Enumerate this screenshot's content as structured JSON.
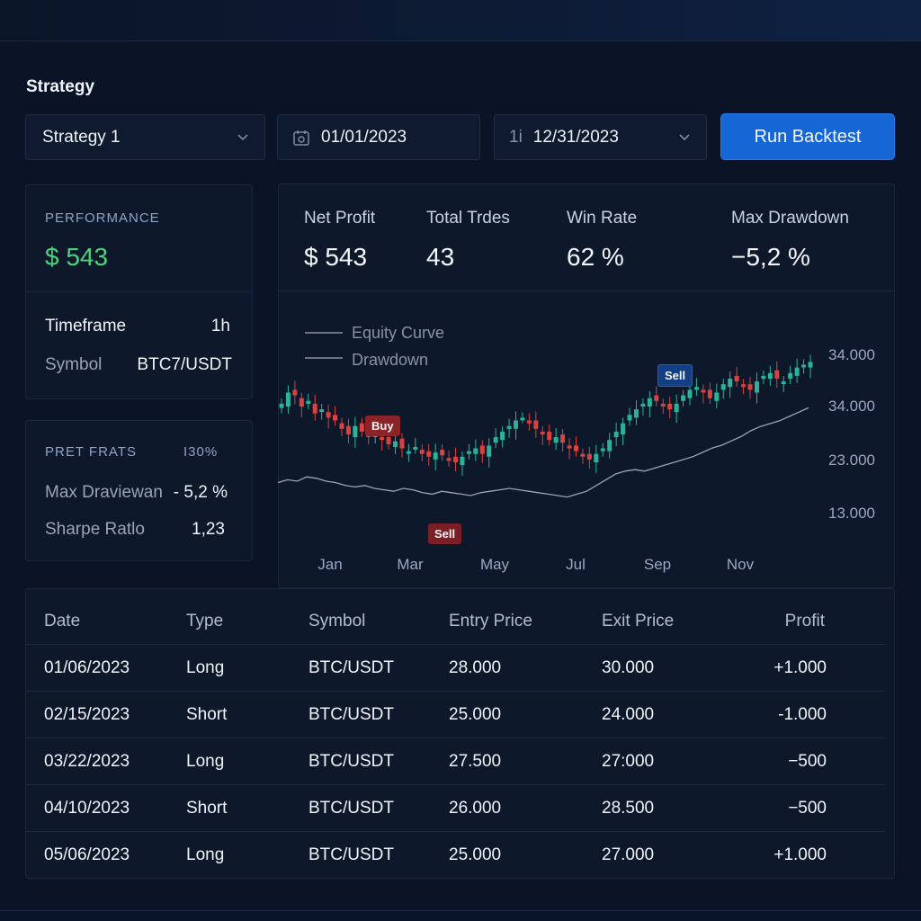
{
  "strategy": {
    "section_title": "Strategy",
    "selected": "Strategy 1",
    "start_date": "01/01/2023",
    "end_date": "12/31/2023",
    "end_date_icon_text": "1i",
    "run_label": "Run Backtest"
  },
  "performance": {
    "title": "PERFORMANCE",
    "value": "$ 543",
    "timeframe_label": "Timeframe",
    "timeframe_value": "1h",
    "symbol_label": "Symbol",
    "symbol_value": "BTC‌7/USDT"
  },
  "pret": {
    "title": "PRET FRATS",
    "badge": "I30%",
    "maxdd_label": "Max Draviewan",
    "maxdd_value": "- 5,2 %",
    "sharpe_label": "Sharpe Ratlo",
    "sharpe_value": "1,23"
  },
  "stats": [
    {
      "label": "Net Profit",
      "value": "$ 543"
    },
    {
      "label": "Total Trdes",
      "value": "43"
    },
    {
      "label": "Win Rate",
      "value": "62 %"
    },
    {
      "label": "Max Drawdown",
      "value": "−5,2 %"
    }
  ],
  "chart_data": {
    "type": "candlestick",
    "legend": [
      "Equity Curve",
      "Drawdown"
    ],
    "x_ticks": [
      "Jan",
      "Mar",
      "May",
      "Jul",
      "Sep",
      "Nov"
    ],
    "y_ticks": [
      "34.000",
      "34.000",
      "23.000",
      "13.000"
    ],
    "annotations": [
      {
        "label": "Buy",
        "month": "Feb"
      },
      {
        "label": "Sell",
        "month": "Apr"
      },
      {
        "label": "Sell",
        "month": "Sep"
      }
    ],
    "colors": {
      "up": "#2bb39a",
      "down": "#d9433f",
      "line": "#a9b3c4",
      "buy": "#8a2428",
      "sell_red": "#7a1f26",
      "sell_blue": "#123f86"
    },
    "candle_close_path": [
      62,
      70,
      68,
      60,
      64,
      55,
      58,
      52,
      50,
      44,
      40,
      46,
      42,
      38,
      40,
      36,
      33,
      35,
      30,
      28,
      31,
      26,
      24,
      27,
      25,
      22,
      20,
      24,
      28,
      30,
      26,
      32,
      38,
      42,
      46,
      50,
      52,
      48,
      44,
      40,
      36,
      38,
      34,
      30,
      28,
      24,
      22,
      26,
      30,
      36,
      42,
      48,
      54,
      58,
      62,
      66,
      64,
      60,
      58,
      62,
      68,
      72,
      74,
      70,
      66,
      70,
      76,
      80,
      78,
      74,
      72,
      78,
      82,
      84,
      80,
      78,
      84,
      88,
      90,
      92
    ],
    "line_path": [
      24,
      26,
      25,
      28,
      27,
      25,
      24,
      22,
      21,
      22,
      20,
      19,
      18,
      20,
      19,
      17,
      16,
      18,
      17,
      16,
      15,
      17,
      18,
      19,
      20,
      19,
      18,
      17,
      16,
      15,
      14,
      16,
      18,
      22,
      26,
      30,
      32,
      33,
      32,
      34,
      36,
      38,
      40,
      42,
      45,
      48,
      50,
      53,
      56,
      60,
      63,
      65,
      67,
      70,
      73,
      76
    ]
  },
  "table": {
    "headers": [
      "Date",
      "Type",
      "Symbol",
      "Entry Price",
      "Exit Price",
      "Profit"
    ],
    "rows": [
      {
        "date": "01/06/2023",
        "type": "Long",
        "symbol": "BTC/USDT",
        "entry": "28.000",
        "exit": "30.000",
        "profit": "+1.000",
        "pos": true
      },
      {
        "date": "02/15/2023",
        "type": "Short",
        "symbol": "BTC/USDT",
        "entry": "25.000",
        "exit": "24.000",
        "profit": "-1.000",
        "pos": false
      },
      {
        "date": "03/22/2023",
        "type": "Long",
        "symbol": "BTC/USDT",
        "entry": "27.500",
        "exit": "27:000",
        "profit": "−500",
        "pos": false
      },
      {
        "date": "04/10/2023",
        "type": "Short",
        "symbol": "BTC/USDT",
        "entry": "26.000",
        "exit": "28.500",
        "profit": "−500",
        "pos": false
      },
      {
        "date": "05/06/2023",
        "type": "Long",
        "symbol": "BTC/USDT",
        "entry": "25.000",
        "exit": "27.000",
        "profit": "+1.000",
        "pos": true
      }
    ]
  }
}
